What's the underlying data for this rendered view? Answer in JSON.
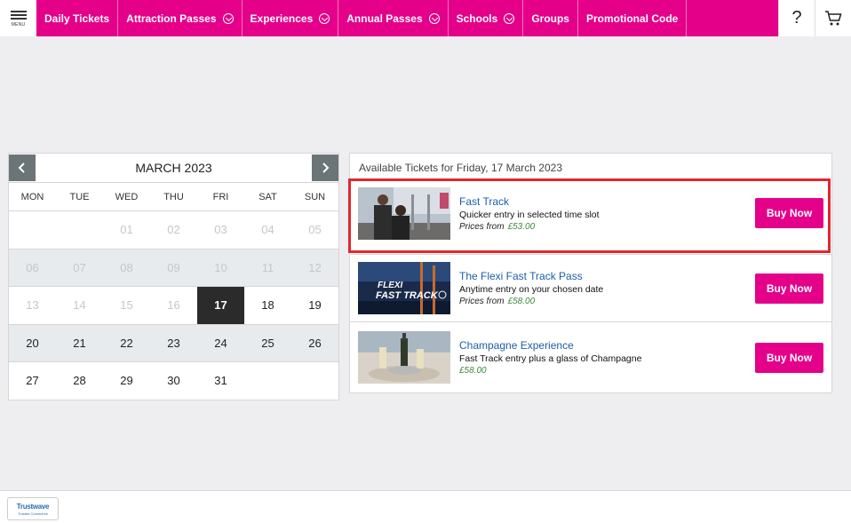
{
  "nav": {
    "menu_label": "MENU",
    "items": [
      {
        "label": "Daily Tickets",
        "dropdown": false
      },
      {
        "label": "Attraction Passes",
        "dropdown": true
      },
      {
        "label": "Experiences",
        "dropdown": true
      },
      {
        "label": "Annual Passes",
        "dropdown": true
      },
      {
        "label": "Schools",
        "dropdown": true
      },
      {
        "label": "Groups",
        "dropdown": false
      },
      {
        "label": "Promotional Code",
        "dropdown": false
      }
    ],
    "help_icon": "question-icon",
    "cart_icon": "cart-icon",
    "brand_color": "#e5008a"
  },
  "calendar": {
    "title": "MARCH 2023",
    "weekdays": [
      "MON",
      "TUE",
      "WED",
      "THU",
      "FRI",
      "SAT",
      "SUN"
    ],
    "weeks": [
      [
        "",
        "",
        "01",
        "02",
        "03",
        "04",
        "05"
      ],
      [
        "06",
        "07",
        "08",
        "09",
        "10",
        "11",
        "12"
      ],
      [
        "13",
        "14",
        "15",
        "16",
        "17",
        "18",
        "19"
      ],
      [
        "20",
        "21",
        "22",
        "23",
        "24",
        "25",
        "26"
      ],
      [
        "27",
        "28",
        "29",
        "30",
        "31",
        "",
        ""
      ]
    ],
    "selected": "17",
    "first_available": "17"
  },
  "tickets": {
    "heading": "Available Tickets for Friday, 17 March 2023",
    "buy_label": "Buy Now",
    "items": [
      {
        "name": "Fast Track",
        "desc": "Quicker entry in selected time slot",
        "price_prefix": "Prices from",
        "price": "£53.00"
      },
      {
        "name": "The Flexi Fast Track Pass",
        "desc": "Anytime entry on your chosen date",
        "price_prefix": "Prices from",
        "price": "£58.00"
      },
      {
        "name": "Champagne Experience",
        "desc": "Fast Track entry plus a glass of Champagne",
        "price_prefix": "",
        "price": "£58.00"
      }
    ],
    "flexi_thumb_text": {
      "line1": "FLEXI",
      "line2": "FAST TRACK"
    }
  },
  "footer": {
    "badge_title": "Trustwave",
    "badge_subtitle": "Trusted Commerce"
  }
}
